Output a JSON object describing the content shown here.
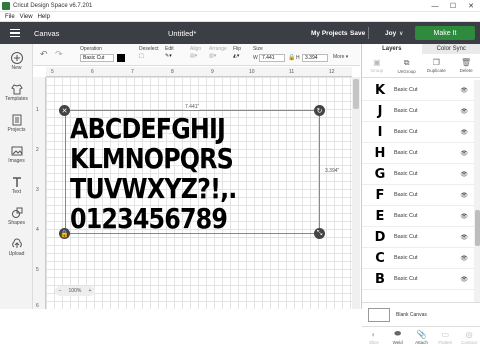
{
  "window": {
    "title": "Cricut Design Space  v6.7.201",
    "buttons": [
      "—",
      "☐",
      "✕"
    ]
  },
  "menu": [
    "File",
    "View",
    "Help"
  ],
  "header": {
    "canvas_label": "Canvas",
    "doc_title": "Untitled*",
    "my_projects": "My Projects",
    "save": "Save",
    "user": "Joy",
    "make_it": "Make It"
  },
  "sidebar": [
    {
      "icon": "plus-icon",
      "label": "New"
    },
    {
      "icon": "shirt-icon",
      "label": "Templates"
    },
    {
      "icon": "projects-icon",
      "label": "Projects"
    },
    {
      "icon": "images-icon",
      "label": "Images"
    },
    {
      "icon": "text-icon",
      "label": "Text"
    },
    {
      "icon": "shapes-icon",
      "label": "Shapes"
    },
    {
      "icon": "upload-icon",
      "label": "Upload"
    }
  ],
  "toolbar": {
    "operation_label": "Operation",
    "operation_value": "Basic Cut",
    "deselect": "Deselect",
    "edit": "Edit",
    "align": "Align",
    "arrange": "Arrange",
    "flip": "Flip",
    "size_label": "Size",
    "size_w_prefix": "W",
    "size_w": "7.441",
    "size_h_prefix": "H",
    "size_h": "3.394",
    "more": "More ▾"
  },
  "ruler": {
    "top": [
      "5",
      "6",
      "7",
      "8",
      "9",
      "10",
      "11",
      "12"
    ],
    "left": [
      "1",
      "2",
      "3",
      "4",
      "5",
      "6"
    ]
  },
  "canvas": {
    "width_label": "7.441\"",
    "height_label": "3.394\"",
    "rows": [
      "ABCDEFGHIJ",
      "KLMNOPQRS",
      "TUVWXYZ?!,.",
      "0123456789"
    ],
    "zoom_minus": "–",
    "zoom_value": "100%",
    "zoom_plus": "+"
  },
  "panel": {
    "tabs": [
      "Layers",
      "Color Sync"
    ],
    "actions": [
      {
        "icon": "group-icon",
        "label": "Group",
        "enabled": false
      },
      {
        "icon": "ungroup-icon",
        "label": "UnGroup",
        "enabled": true
      },
      {
        "icon": "duplicate-icon",
        "label": "Duplicate",
        "enabled": true
      },
      {
        "icon": "delete-icon",
        "label": "Delete",
        "enabled": true
      }
    ],
    "layers": [
      {
        "glyph": "K",
        "label": "Basic Cut"
      },
      {
        "glyph": "J",
        "label": "Basic Cut"
      },
      {
        "glyph": "I",
        "label": "Basic Cut"
      },
      {
        "glyph": "H",
        "label": "Basic Cut"
      },
      {
        "glyph": "G",
        "label": "Basic Cut"
      },
      {
        "glyph": "F",
        "label": "Basic Cut"
      },
      {
        "glyph": "E",
        "label": "Basic Cut"
      },
      {
        "glyph": "D",
        "label": "Basic Cut"
      },
      {
        "glyph": "C",
        "label": "Basic Cut"
      },
      {
        "glyph": "B",
        "label": "Basic Cut"
      }
    ],
    "blank_canvas": "Blank Canvas",
    "bottom_actions": [
      {
        "icon": "slice-icon",
        "label": "Slice",
        "enabled": false
      },
      {
        "icon": "weld-icon",
        "label": "Weld",
        "enabled": true
      },
      {
        "icon": "attach-icon",
        "label": "Attach",
        "enabled": true
      },
      {
        "icon": "flatten-icon",
        "label": "Flatten",
        "enabled": false
      },
      {
        "icon": "contour-icon",
        "label": "Contour",
        "enabled": false
      }
    ]
  },
  "colors": {
    "accent": "#2e8b3d",
    "header": "#3b3e45"
  }
}
